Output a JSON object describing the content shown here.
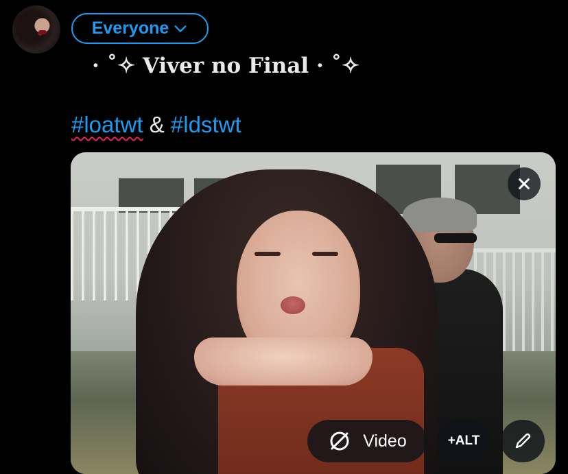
{
  "composer": {
    "audience_label": "Everyone",
    "title_text": "· ˚✧ Viver no Final · ˚✧",
    "hashtag_1": "#loatwt",
    "connector": "&",
    "hashtag_2": "#ldstwt"
  },
  "media": {
    "video_label": "Video",
    "alt_label": "+ALT"
  },
  "icons": {
    "audience_chevron": "chevron-down-icon",
    "remove": "close-icon",
    "video_toggle": "no-sound-icon",
    "edit": "pencil-icon"
  },
  "colors": {
    "accent": "#1d9bf0",
    "background": "#000000",
    "overlay_button": "#0f1419"
  }
}
